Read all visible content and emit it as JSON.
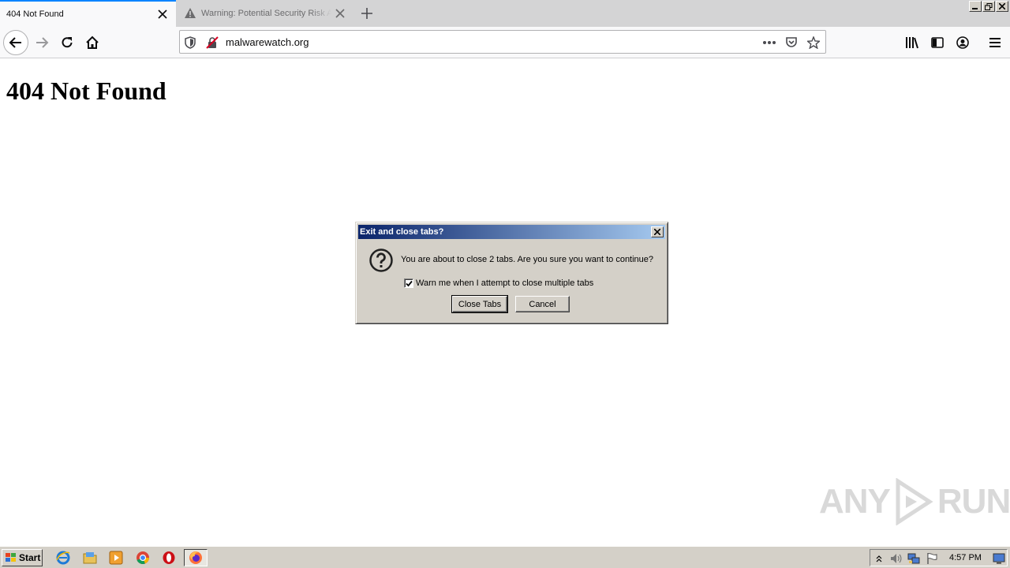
{
  "browser": {
    "tabs": [
      {
        "title": "404 Not Found",
        "active": true
      },
      {
        "title": "Warning: Potential Security Risk Ahead",
        "active": false
      }
    ],
    "url": "malwarewatch.org"
  },
  "page": {
    "heading": "404 Not Found"
  },
  "dialog": {
    "title": "Exit and close tabs?",
    "message": "You are about to close 2 tabs. Are you sure you want to continue?",
    "checkbox_label": "Warn me when I attempt to close multiple tabs",
    "checkbox_checked": true,
    "close_tabs_label": "Close Tabs",
    "cancel_label": "Cancel"
  },
  "watermark": {
    "left": "ANY",
    "right": "RUN"
  },
  "taskbar": {
    "start_label": "Start",
    "time": "4:57 PM"
  },
  "colors": {
    "tab_accent": "#0a84ff",
    "dialog_title_start": "#0a246a",
    "dialog_title_end": "#a6caf0",
    "classic_face": "#d4d0c8"
  }
}
